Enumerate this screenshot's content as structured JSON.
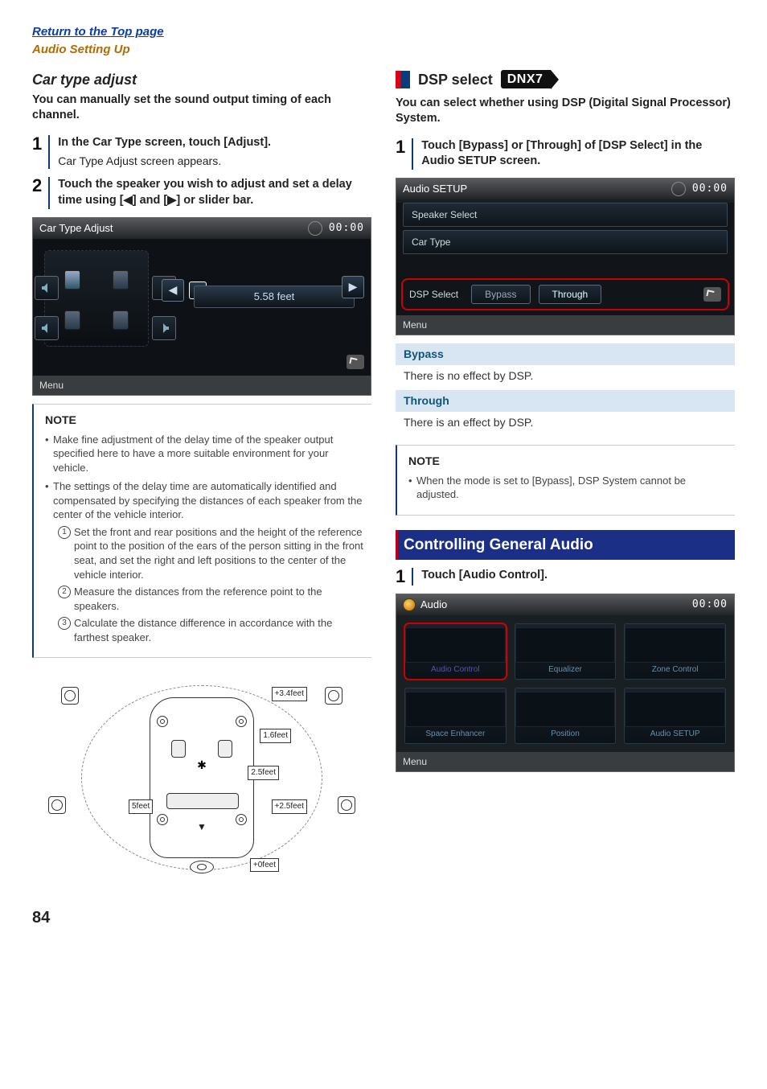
{
  "top": {
    "return": "Return to the Top page",
    "section": "Audio Setting Up"
  },
  "left": {
    "heading": "Car type adjust",
    "lead": "You can manually set the sound output timing of each channel.",
    "step1": {
      "num": "1",
      "head": "In the Car Type screen, touch [Adjust].",
      "sub": "Car Type Adjust screen appears."
    },
    "step2": {
      "num": "2",
      "head": "Touch the speaker you wish to adjust and set a delay time using [◀] and [▶] or slider bar."
    },
    "cta_scr": {
      "title": "Car Type Adjust",
      "time": "00:00",
      "feet": "5.58 feet",
      "menu": "Menu"
    },
    "note_title": "NOTE",
    "note_b1": "Make fine adjustment of the delay time of the speaker output specified here to have a more suitable environment for your vehicle.",
    "note_b2": "The settings of the delay time are automatically identified and compensated by specifying the distances of each speaker from the center of the vehicle interior.",
    "note_o1": "Set the front and rear positions and the height of the reference point to the position of the ears of the person sitting in the front seat, and set the right and left positions to the center of the vehicle interior.",
    "note_o2": "Measure the distances from the reference point to the speakers.",
    "note_o3": "Calculate the distance difference in accordance with the farthest speaker.",
    "diagram_labels": {
      "a": "+3.4feet",
      "b": "1.6feet",
      "c": "2.5feet",
      "d": "5feet",
      "e": "+2.5feet",
      "f": "+0feet"
    }
  },
  "right": {
    "h2": "DSP select",
    "badge": "DNX7",
    "lead": "You can select whether using DSP (Digital Signal Processor) System.",
    "step1": {
      "num": "1",
      "head": "Touch [Bypass] or [Through] of [DSP Select] in the Audio SETUP screen."
    },
    "dsp_scr": {
      "title": "Audio SETUP",
      "time": "00:00",
      "row1": "Speaker Select",
      "row2": "Car Type",
      "dsp_label": "DSP Select",
      "btn1": "Bypass",
      "btn2": "Through",
      "menu": "Menu"
    },
    "def1_title": "Bypass",
    "def1_text": "There is no effect by DSP.",
    "def2_title": "Through",
    "def2_text": "There is an effect by DSP.",
    "note_title": "NOTE",
    "note_b1": "When the mode is set to [Bypass], DSP System cannot be adjusted.",
    "sec_heading": "Controlling General Audio",
    "step2": {
      "num": "1",
      "head": "Touch [Audio Control]."
    },
    "audio_scr": {
      "title": "Audio",
      "time": "00:00",
      "tiles": [
        "Audio Control",
        "Equalizer",
        "Zone Control",
        "Space Enhancer",
        "Position",
        "Audio SETUP"
      ],
      "menu": "Menu"
    }
  },
  "pagenum": "84"
}
